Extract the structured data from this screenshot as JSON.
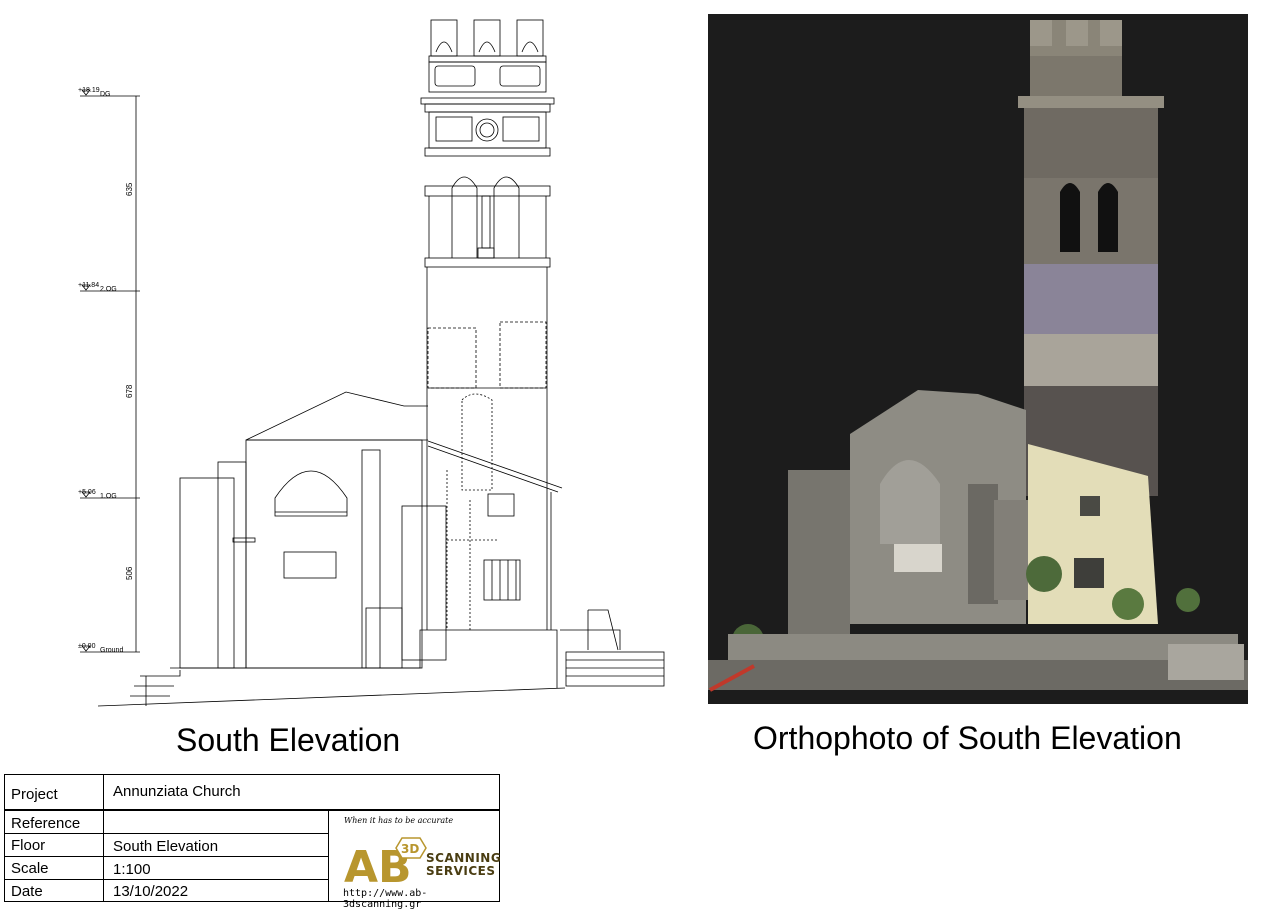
{
  "drawing": {
    "levels": [
      {
        "value": "+18.19",
        "label": "DG"
      },
      {
        "value": "+11.84",
        "label": "2.OG"
      },
      {
        "value": "+5.06",
        "label": "1.OG"
      },
      {
        "value": "±0.00",
        "label": "Ground"
      }
    ],
    "dimensions": [
      "635",
      "678",
      "506"
    ]
  },
  "captions": {
    "left": "South Elevation",
    "right": "Orthophoto of South Elevation"
  },
  "title_block": {
    "project_label": "Project",
    "project_value": "Annunziata Church",
    "reference_label": "Reference",
    "reference_value": "",
    "floor_label": "Floor",
    "floor_value": "South Elevation",
    "scale_label": "Scale",
    "scale_value": "1:100",
    "date_label": "Date",
    "date_value": "13/10/2022"
  },
  "logo": {
    "tagline": "When it has to be accurate",
    "letters": "AB",
    "badge": "3D",
    "word1": "SCANNING",
    "word2": "SERVICES",
    "url": "http://www.ab-3dscanning.gr",
    "colors": {
      "gold": "#b8962e",
      "dark": "#3a2f10"
    }
  }
}
